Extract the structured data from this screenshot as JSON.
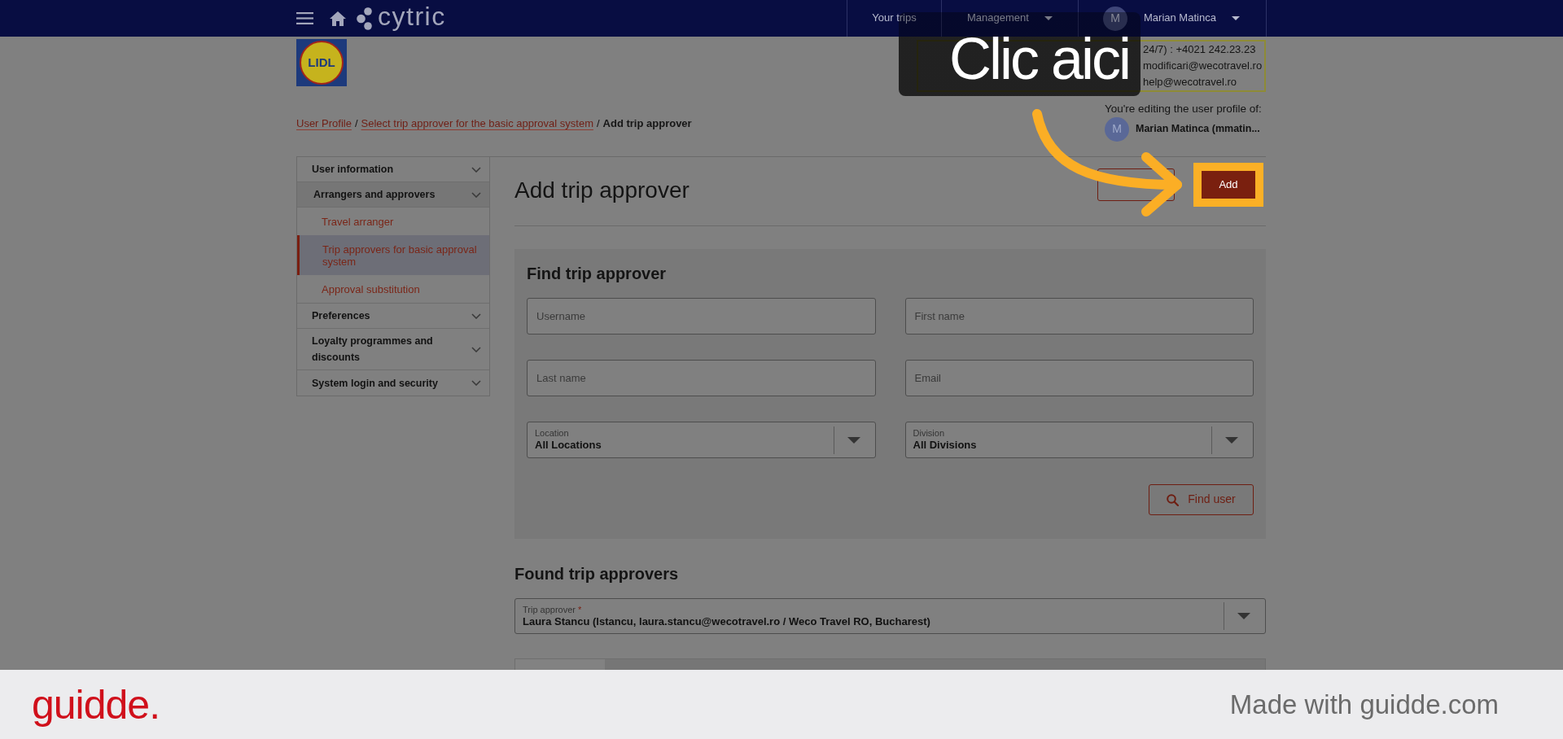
{
  "navbar": {
    "brand": "cytric",
    "items": [
      {
        "kind": "link",
        "label": "Your trips"
      },
      {
        "kind": "dropdown",
        "label": "Management"
      },
      {
        "kind": "user",
        "avatar": "M",
        "label": "Marian Matinca"
      }
    ]
  },
  "logo": {
    "text": "LIDL"
  },
  "notice": {
    "lines": [
      "24/7) : +4021 242.23.23",
      "modificari@wecotravel.ro",
      "help@wecotravel.ro"
    ]
  },
  "breadcrumb": {
    "separator": "/",
    "items": [
      {
        "label": "User Profile",
        "current": false
      },
      {
        "label": "Select trip approver for the basic approval system",
        "current": false
      },
      {
        "label": "Add trip approver",
        "current": true
      }
    ]
  },
  "editing": {
    "caption": "You're editing the user profile of:",
    "avatar": "M",
    "name": "Marian Matinca (mmatin..."
  },
  "sidebar": [
    {
      "label": "User information",
      "expanded": false
    },
    {
      "label": "Arrangers and approvers",
      "expanded": true,
      "children": [
        {
          "label": "Travel arranger",
          "selected": false
        },
        {
          "label": "Trip approvers for basic approval system",
          "selected": true
        },
        {
          "label": "Approval substitution",
          "selected": false
        }
      ]
    },
    {
      "label": "Preferences",
      "expanded": false
    },
    {
      "label": "Loyalty programmes and discounts",
      "expanded": false
    },
    {
      "label": "System login and security",
      "expanded": false
    }
  ],
  "page": {
    "title": "Add trip approver",
    "buttons": [
      {
        "kind": "outline",
        "highlighted": false
      },
      {
        "kind": "primary",
        "label": "Add",
        "highlighted": true
      }
    ]
  },
  "search": {
    "title": "Find trip approver",
    "fields": [
      {
        "kind": "text",
        "placeholder": "Username"
      },
      {
        "kind": "text",
        "placeholder": "First name"
      },
      {
        "kind": "text",
        "placeholder": "Last name"
      },
      {
        "kind": "text",
        "placeholder": "Email"
      },
      {
        "kind": "select",
        "label": "Location",
        "value": "All Locations"
      },
      {
        "kind": "select",
        "label": "Division",
        "value": "All Divisions"
      }
    ],
    "button": {
      "label": "Find user"
    }
  },
  "results": {
    "title": "Found trip approvers",
    "approver": {
      "label": "Trip approver",
      "required_mark": "*",
      "value": "Laura Stancu (lstancu, laura.stancu@wecotravel.ro / Weco Travel RO, Bucharest)"
    }
  },
  "callout": {
    "text": "Clic aici"
  },
  "footer": {
    "logo": "guidde.",
    "caption": "Made with guidde.com"
  }
}
